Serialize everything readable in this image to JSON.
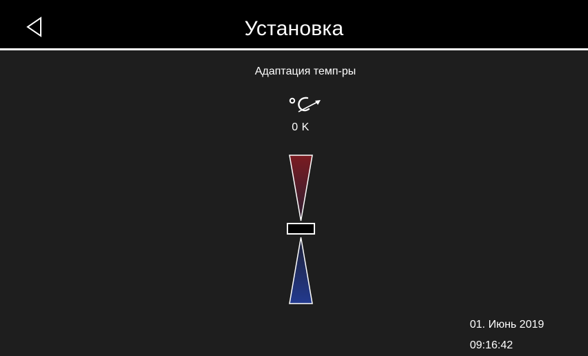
{
  "header": {
    "title": "Установка",
    "back_icon": "back-triangle-icon"
  },
  "parameter": {
    "label": "Адаптация темп-ры",
    "icon": "temperature-adaptation-icon",
    "value": "0 K",
    "level": 0
  },
  "slider": {
    "increase_color_top": "#7a1c21",
    "increase_color_bottom": "#2c1f33",
    "decrease_color_top": "#1e2136",
    "decrease_color_bottom": "#233a8f"
  },
  "status": {
    "date": "01. Июнь 2019",
    "time": "09:16:42"
  },
  "colors": {
    "background": "#1e1e1e",
    "header": "#000000",
    "text": "#ffffff"
  }
}
